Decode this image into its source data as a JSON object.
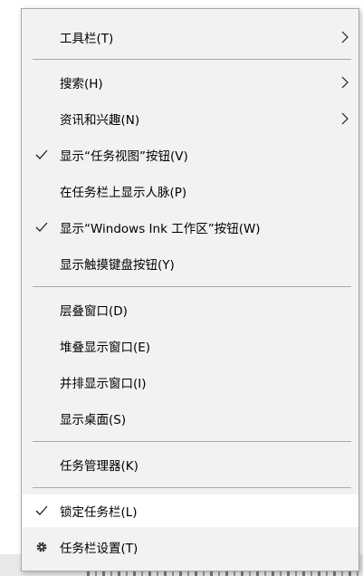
{
  "menu": {
    "items": [
      {
        "label": "工具栏(T)"
      },
      {
        "label": "搜索(H)"
      },
      {
        "label": "资讯和兴趣(N)"
      },
      {
        "label": "显示“任务视图”按钮(V)"
      },
      {
        "label": "在任务栏上显示人脉(P)"
      },
      {
        "label": "显示“Windows Ink 工作区”按钮(W)"
      },
      {
        "label": "显示触摸键盘按钮(Y)"
      },
      {
        "label": "层叠窗口(D)"
      },
      {
        "label": "堆叠显示窗口(E)"
      },
      {
        "label": "并排显示窗口(I)"
      },
      {
        "label": "显示桌面(S)"
      },
      {
        "label": "任务管理器(K)"
      },
      {
        "label": "锁定任务栏(L)"
      },
      {
        "label": "任务栏设置(T)"
      }
    ]
  },
  "icons": {
    "submenu": "chevron-right-icon",
    "checked": "checkmark-icon",
    "settings": "gear-icon"
  }
}
